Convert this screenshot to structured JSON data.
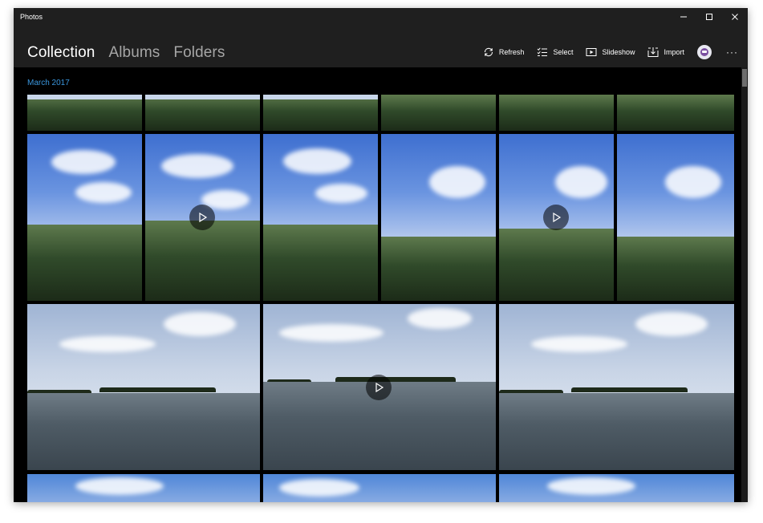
{
  "window": {
    "title": "Photos"
  },
  "nav": {
    "tabs": [
      {
        "label": "Collection",
        "active": true
      },
      {
        "label": "Albums",
        "active": false
      },
      {
        "label": "Folders",
        "active": false
      }
    ]
  },
  "toolbar": {
    "refresh_label": "Refresh",
    "select_label": "Select",
    "slideshow_label": "Slideshow",
    "import_label": "Import",
    "more_label": "···"
  },
  "collection": {
    "date_header": "March 2017"
  },
  "colors": {
    "accent": "#3a96dd",
    "background": "#000000",
    "chrome": "#1f1f1f"
  },
  "photos": {
    "row1": [
      "photo",
      "photo",
      "photo",
      "photo",
      "photo",
      "photo"
    ],
    "row2": [
      "photo",
      "video",
      "photo",
      "photo",
      "video",
      "photo"
    ],
    "row3": [
      "photo",
      "video",
      "photo"
    ],
    "row4": [
      "photo",
      "photo",
      "photo"
    ]
  }
}
